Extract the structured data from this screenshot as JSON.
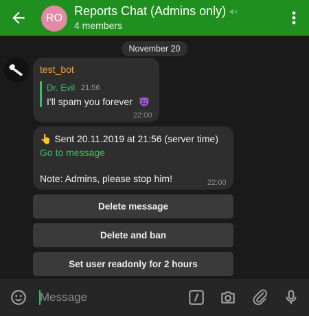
{
  "header": {
    "title": "Reports Chat (Admins only)",
    "subtitle": "4 members",
    "avatar_initials": "RO",
    "icons": [
      "arrow-left-icon",
      "muted-speaker-icon",
      "kebab-menu-icon"
    ]
  },
  "date_separator": "November 20",
  "messages": [
    {
      "sender": "test_bot",
      "quote": {
        "name": "Dr. Evil",
        "time": "21:56",
        "text": "I'll spam you forever"
      },
      "time": "22:00"
    },
    {
      "line1": "Sent 20.11.2019 at 21:56 (server time)",
      "link": "Go to message",
      "note": "Note: Admins, please stop him!",
      "time": "22:00"
    }
  ],
  "keyboard_buttons": [
    "Delete message",
    "Delete and ban",
    "Set user readonly for 2 hours"
  ],
  "composer": {
    "placeholder": "Message",
    "icons": [
      "emoji-icon",
      "slash-command-icon",
      "camera-icon",
      "paperclip-icon",
      "microphone-icon"
    ]
  },
  "colors": {
    "header_bg": "#1f8f1f",
    "accent_green": "#3fbf63",
    "sender_orange": "#f0a13a",
    "avatar_pink": "#e48aa6"
  }
}
